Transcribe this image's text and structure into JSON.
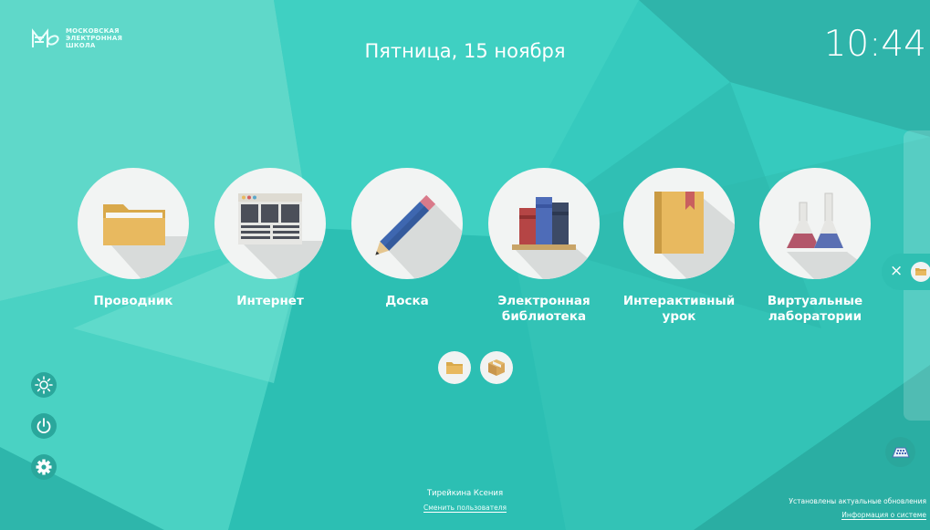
{
  "logo": {
    "line1": "МОСКОВСКАЯ",
    "line2": "ЭЛЕКТРОННАЯ",
    "line3": "ШКОЛА"
  },
  "header": {
    "date": "Пятница, 15 ноября",
    "time": "10:44"
  },
  "apps": [
    {
      "line1": "Проводник",
      "line2": "",
      "icon": "folder-icon"
    },
    {
      "line1": "Интернет",
      "line2": "",
      "icon": "browser-icon"
    },
    {
      "line1": "Доска",
      "line2": "",
      "icon": "pencil-icon"
    },
    {
      "line1": "Электронная",
      "line2": "библиотека",
      "icon": "books-icon"
    },
    {
      "line1": "Интерактивный",
      "line2": "урок",
      "icon": "book-icon"
    },
    {
      "line1": "Виртуальные",
      "line2": "лаборатории",
      "icon": "flasks-icon"
    }
  ],
  "panel": {
    "close_label": "×"
  },
  "footer": {
    "user_name": "Тирейкина Ксения",
    "change_user": "Сменить пользователя",
    "updates_status": "Установлены актуальные обновления",
    "system_info": "Информация о системе"
  },
  "colors": {
    "background": "#35c9bd",
    "button": "#2aa79c",
    "circle": "#f2f4f3",
    "folder": "#e8b95f"
  }
}
